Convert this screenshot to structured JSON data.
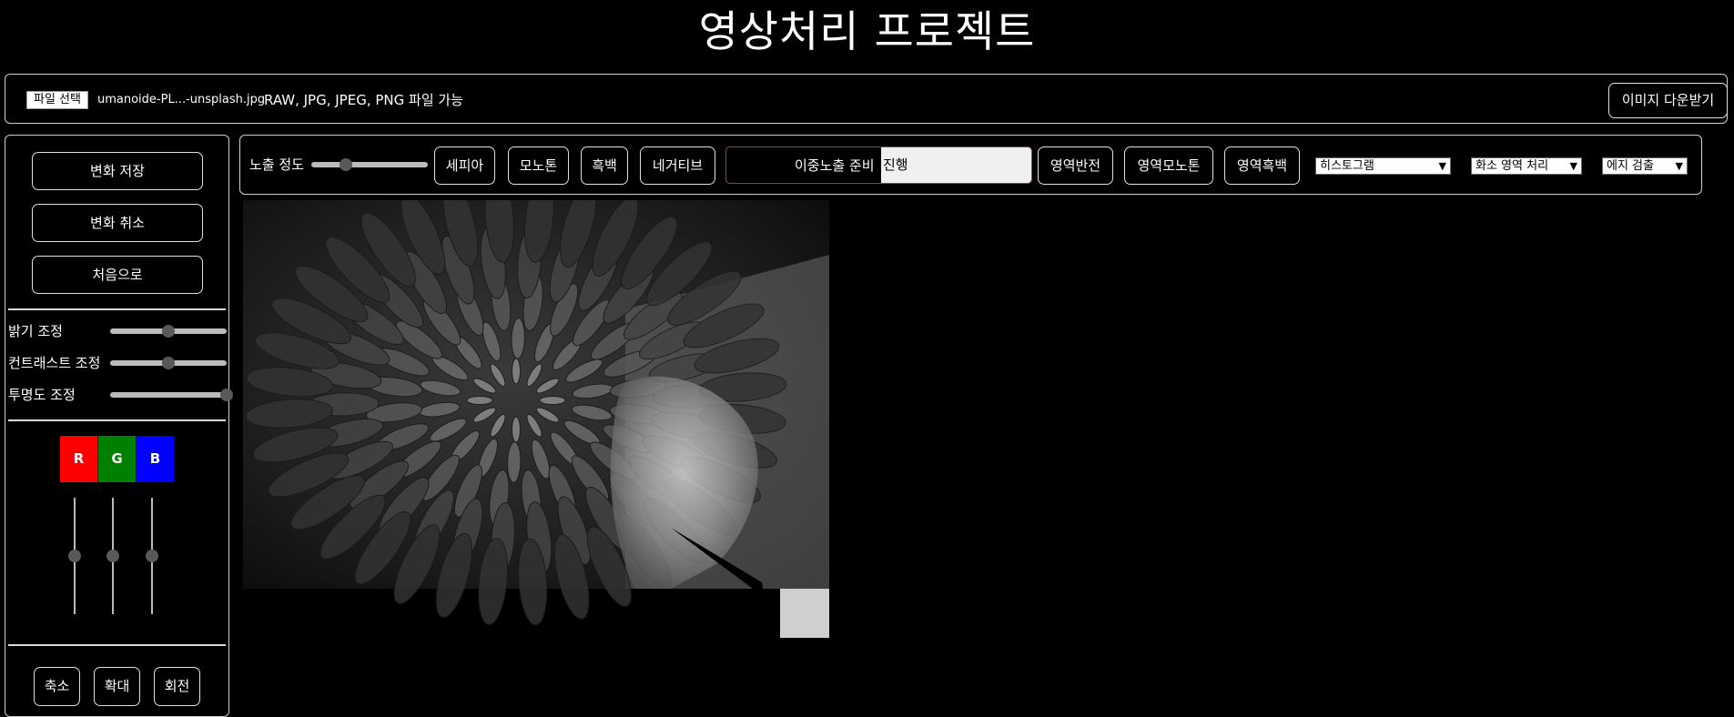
{
  "title": "영상처리 프로젝트",
  "file_bar": {
    "choose_label": "파일 선택",
    "file_name": "umanoide-PL...-unsplash.jpg",
    "note": "RAW, JPG, JPEG, PNG 파일 가능",
    "download_label": "이미지 다운받기"
  },
  "sidebar": {
    "save_label": "변화 저장",
    "undo_label": "변화 취소",
    "reset_label": "처음으로",
    "sliders": [
      {
        "label": "밝기 조정",
        "value": 0.5
      },
      {
        "label": "컨트래스트 조정",
        "value": 0.5
      },
      {
        "label": "투명도 조정",
        "value": 1.0
      }
    ],
    "rgb": [
      {
        "label": "R",
        "color": "#ff0000",
        "value": 0.5
      },
      {
        "label": "G",
        "color": "#008000",
        "value": 0.5
      },
      {
        "label": "B",
        "color": "#0000ff",
        "value": 0.5
      }
    ],
    "shrink_label": "축소",
    "zoom_label": "확대",
    "rotate_label": "회전"
  },
  "toolbar": {
    "exposure_label": "노출 정도",
    "exposure_value": 0.3,
    "sepia_label": "세피아",
    "mono_label": "모노톤",
    "bw_label": "흑백",
    "negative_label": "네거티브",
    "double_label": "이중노출 준비",
    "double_value": "진행",
    "region_invert_label": "영역반전",
    "region_mono_label": "영역모노톤",
    "region_bw_label": "영역흑백",
    "histogram_select": "히스토그램",
    "pixel_select": "화소 영역 처리",
    "edge_select": "에지 검출"
  },
  "colors": {
    "background": "#000000",
    "text": "#ffffff",
    "double_border": "#c03030"
  }
}
